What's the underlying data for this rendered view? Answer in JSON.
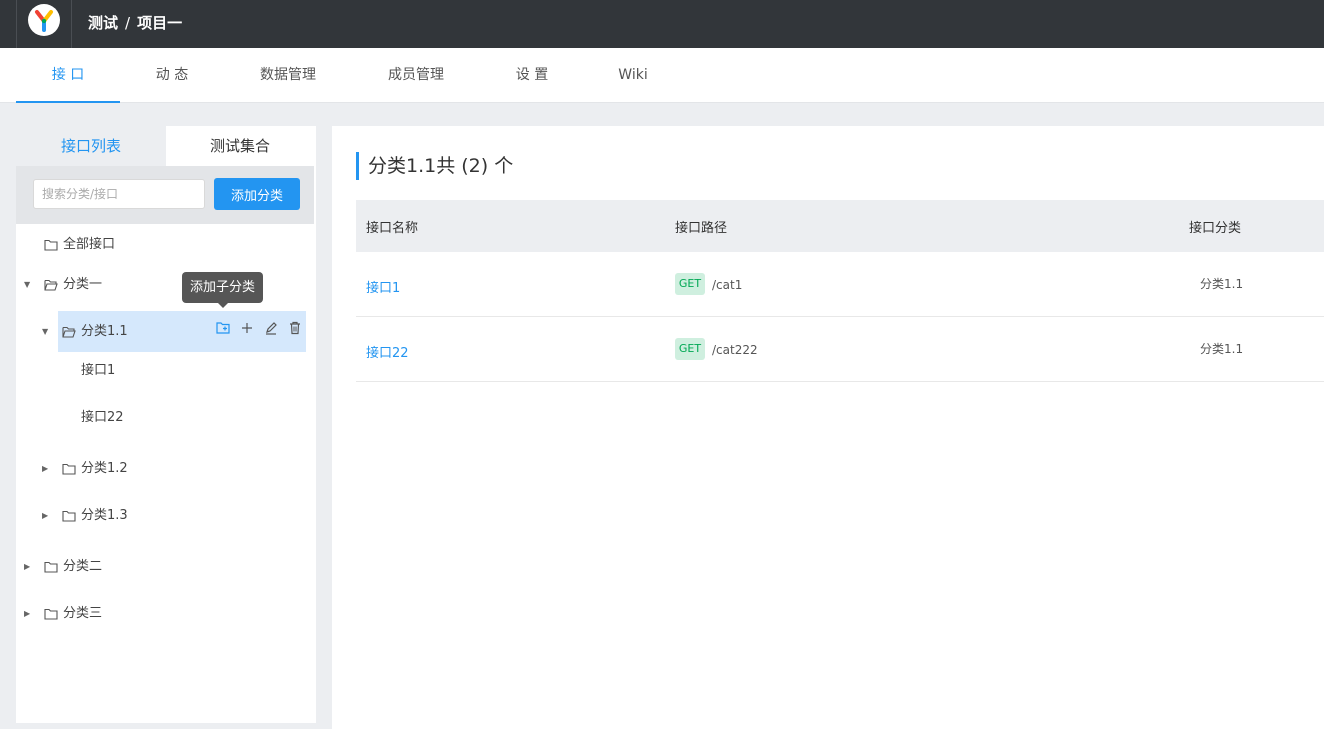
{
  "header": {
    "group": "测试",
    "separator": "/",
    "project": "项目一"
  },
  "tabs": [
    {
      "label": "接 口"
    },
    {
      "label": "动 态"
    },
    {
      "label": "数据管理"
    },
    {
      "label": "成员管理"
    },
    {
      "label": "设 置"
    },
    {
      "label": "Wiki"
    }
  ],
  "sidebar": {
    "tab_list": "接口列表",
    "tab_collection": "测试集合",
    "search_placeholder": "搜索分类/接口",
    "add_category_label": "添加分类",
    "tooltip": "添加子分类",
    "tree": {
      "all": "全部接口",
      "cat1": "分类一",
      "cat1_1": "分类1.1",
      "api1": "接口1",
      "api22": "接口22",
      "cat1_2": "分类1.2",
      "cat1_3": "分类1.3",
      "cat2": "分类二",
      "cat3": "分类三"
    }
  },
  "main": {
    "title": "分类1.1共 (2) 个",
    "columns": [
      "接口名称",
      "接口路径",
      "接口分类"
    ],
    "rows": [
      {
        "name": "接口1",
        "method": "GET",
        "path": "/cat1",
        "category": "分类1.1"
      },
      {
        "name": "接口22",
        "method": "GET",
        "path": "/cat222",
        "category": "分类1.1"
      }
    ]
  },
  "colors": {
    "accent": "#2395f1",
    "topbar": "#32363a",
    "get_badge_bg": "#cfefdf",
    "get_badge_text": "#00a854"
  }
}
